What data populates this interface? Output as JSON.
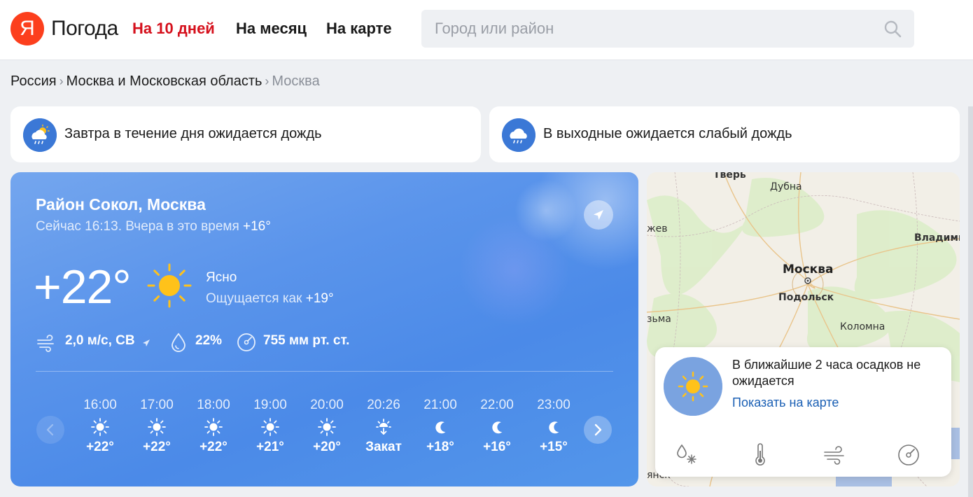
{
  "header": {
    "logo_letter": "Я",
    "logo_text": "Погода",
    "nav": [
      {
        "label": "На 10 дней"
      },
      {
        "label": "На месяц"
      },
      {
        "label": "На карте"
      }
    ],
    "search_placeholder": "Город или район"
  },
  "breadcrumb": {
    "items": [
      "Россия",
      "Москва и Московская область",
      "Москва"
    ],
    "separator": "›"
  },
  "alerts": [
    {
      "text": "Завтра в течение дня ожидается дождь",
      "icon": "cloud-sun-rain-icon"
    },
    {
      "text": "В выходные ожидается слабый дождь",
      "icon": "cloud-rain-icon"
    }
  ],
  "current": {
    "location": "Район Сокол, Москва",
    "now_prefix": "Сейчас 16:13. Вчера в это время",
    "yesterday_temp": "+16°",
    "temp": "+22°",
    "condition": "Ясно",
    "feels_prefix": "Ощущается как",
    "feels_temp": "+19°",
    "wind": "2,0 м/с, СВ",
    "humidity": "22%",
    "pressure": "755 мм рт. ст."
  },
  "hourly": [
    {
      "time": "16:00",
      "icon": "sun-icon",
      "value": "+22°"
    },
    {
      "time": "17:00",
      "icon": "sun-icon",
      "value": "+22°"
    },
    {
      "time": "18:00",
      "icon": "sun-icon",
      "value": "+22°"
    },
    {
      "time": "19:00",
      "icon": "sun-icon",
      "value": "+21°"
    },
    {
      "time": "20:00",
      "icon": "sun-icon",
      "value": "+20°"
    },
    {
      "time": "20:26",
      "icon": "sunset-icon",
      "value": "Закат"
    },
    {
      "time": "21:00",
      "icon": "moon-icon",
      "value": "+18°"
    },
    {
      "time": "22:00",
      "icon": "moon-icon",
      "value": "+16°"
    },
    {
      "time": "23:00",
      "icon": "moon-icon",
      "value": "+15°"
    }
  ],
  "map": {
    "labels": [
      "Тверь",
      "Дубна",
      "Москва",
      "Подольск",
      "Коломна",
      "Владими",
      "жев",
      "зьма",
      "янск"
    ],
    "nowcast_text": "В ближайшие 2 часа осадков не ожидается",
    "nowcast_link": "Показать на карте",
    "layers": [
      "precipitation-icon",
      "thermometer-icon",
      "wind-icon",
      "pressure-gauge-icon"
    ]
  },
  "colors": {
    "brand_red": "#fc3f1d",
    "nav_active": "#d5101c",
    "card_blue": "#4b8ae8",
    "link_blue": "#1a5fb4",
    "sun_yellow": "#ffc21a"
  }
}
